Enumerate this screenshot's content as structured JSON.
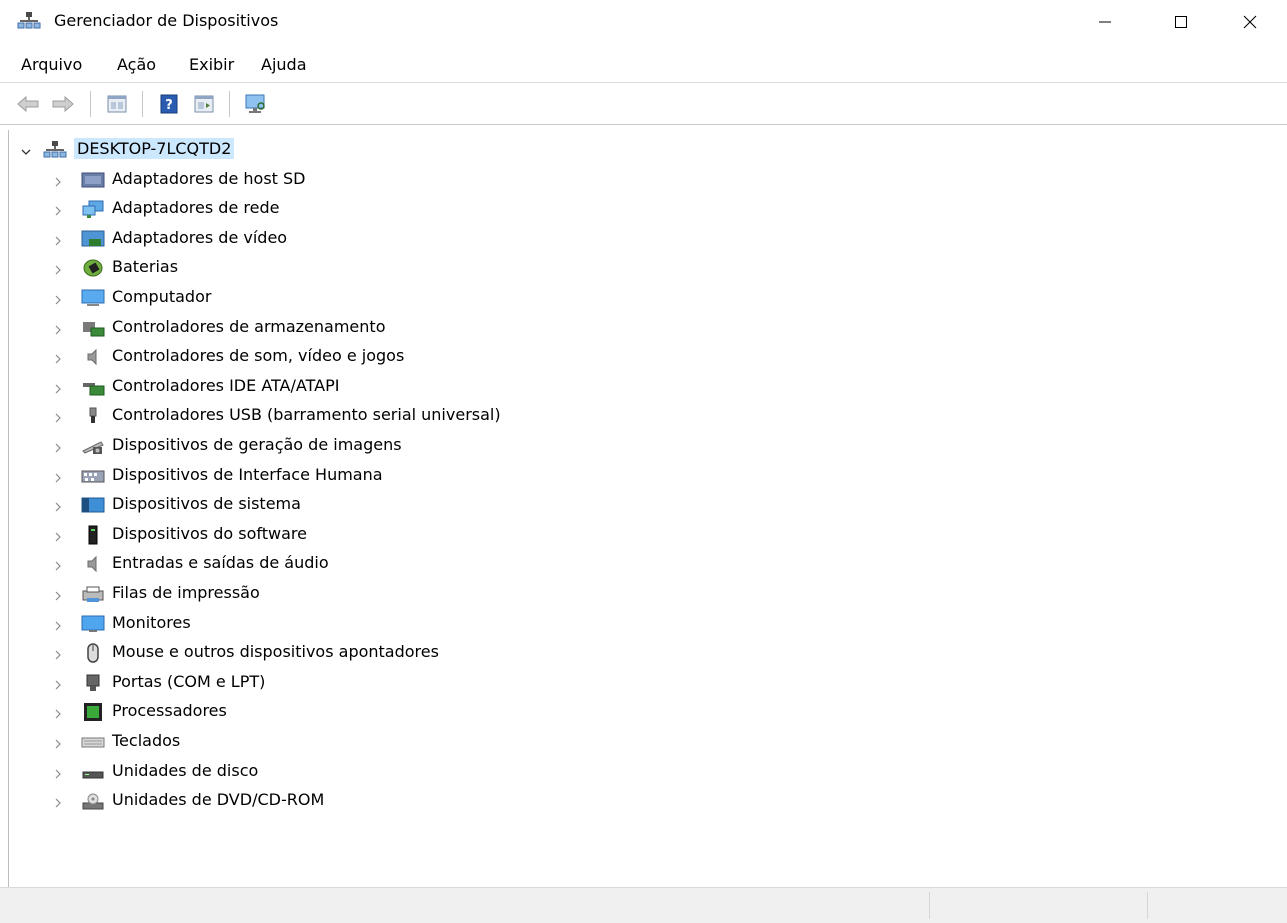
{
  "window": {
    "title": "Gerenciador de Dispositivos"
  },
  "menu": [
    "Arquivo",
    "Ação",
    "Exibir",
    "Ajuda"
  ],
  "toolbar": [
    {
      "name": "back-icon",
      "enabled": false
    },
    {
      "name": "forward-icon",
      "enabled": false
    },
    {
      "name": "properties-icon",
      "enabled": true
    },
    {
      "name": "help-icon",
      "enabled": true
    },
    {
      "name": "details-view-icon",
      "enabled": true
    },
    {
      "name": "scan-hardware-icon",
      "enabled": true
    }
  ],
  "tree": {
    "root": {
      "label": "DESKTOP-7LCQTD2",
      "icon": "computer-network-icon",
      "expanded": true
    },
    "items": [
      {
        "label": "Adaptadores de host SD",
        "icon": "sd-host-icon"
      },
      {
        "label": "Adaptadores de rede",
        "icon": "network-adapter-icon"
      },
      {
        "label": "Adaptadores de vídeo",
        "icon": "display-adapter-icon"
      },
      {
        "label": "Baterias",
        "icon": "battery-icon"
      },
      {
        "label": "Computador",
        "icon": "computer-icon"
      },
      {
        "label": "Controladores de armazenamento",
        "icon": "storage-controller-icon"
      },
      {
        "label": "Controladores de som, vídeo e jogos",
        "icon": "speaker-icon"
      },
      {
        "label": "Controladores IDE ATA/ATAPI",
        "icon": "ide-controller-icon"
      },
      {
        "label": "Controladores USB (barramento serial universal)",
        "icon": "usb-icon"
      },
      {
        "label": "Dispositivos de geração de imagens",
        "icon": "imaging-device-icon"
      },
      {
        "label": "Dispositivos de Interface Humana",
        "icon": "hid-icon"
      },
      {
        "label": "Dispositivos de sistema",
        "icon": "system-devices-icon"
      },
      {
        "label": "Dispositivos do software",
        "icon": "software-device-icon"
      },
      {
        "label": "Entradas e saídas de áudio",
        "icon": "audio-io-icon"
      },
      {
        "label": "Filas de impressão",
        "icon": "print-queue-icon"
      },
      {
        "label": "Monitores",
        "icon": "monitor-icon"
      },
      {
        "label": "Mouse e outros dispositivos apontadores",
        "icon": "mouse-icon"
      },
      {
        "label": "Portas (COM e LPT)",
        "icon": "port-icon"
      },
      {
        "label": "Processadores",
        "icon": "processor-icon"
      },
      {
        "label": "Teclados",
        "icon": "keyboard-icon"
      },
      {
        "label": "Unidades de disco",
        "icon": "disk-drive-icon"
      },
      {
        "label": "Unidades de DVD/CD-ROM",
        "icon": "dvd-drive-icon"
      }
    ]
  },
  "colors": {
    "selection": "#cce8ff",
    "status_bar": "#f0f0f0",
    "expander": "#8a8a8a"
  }
}
